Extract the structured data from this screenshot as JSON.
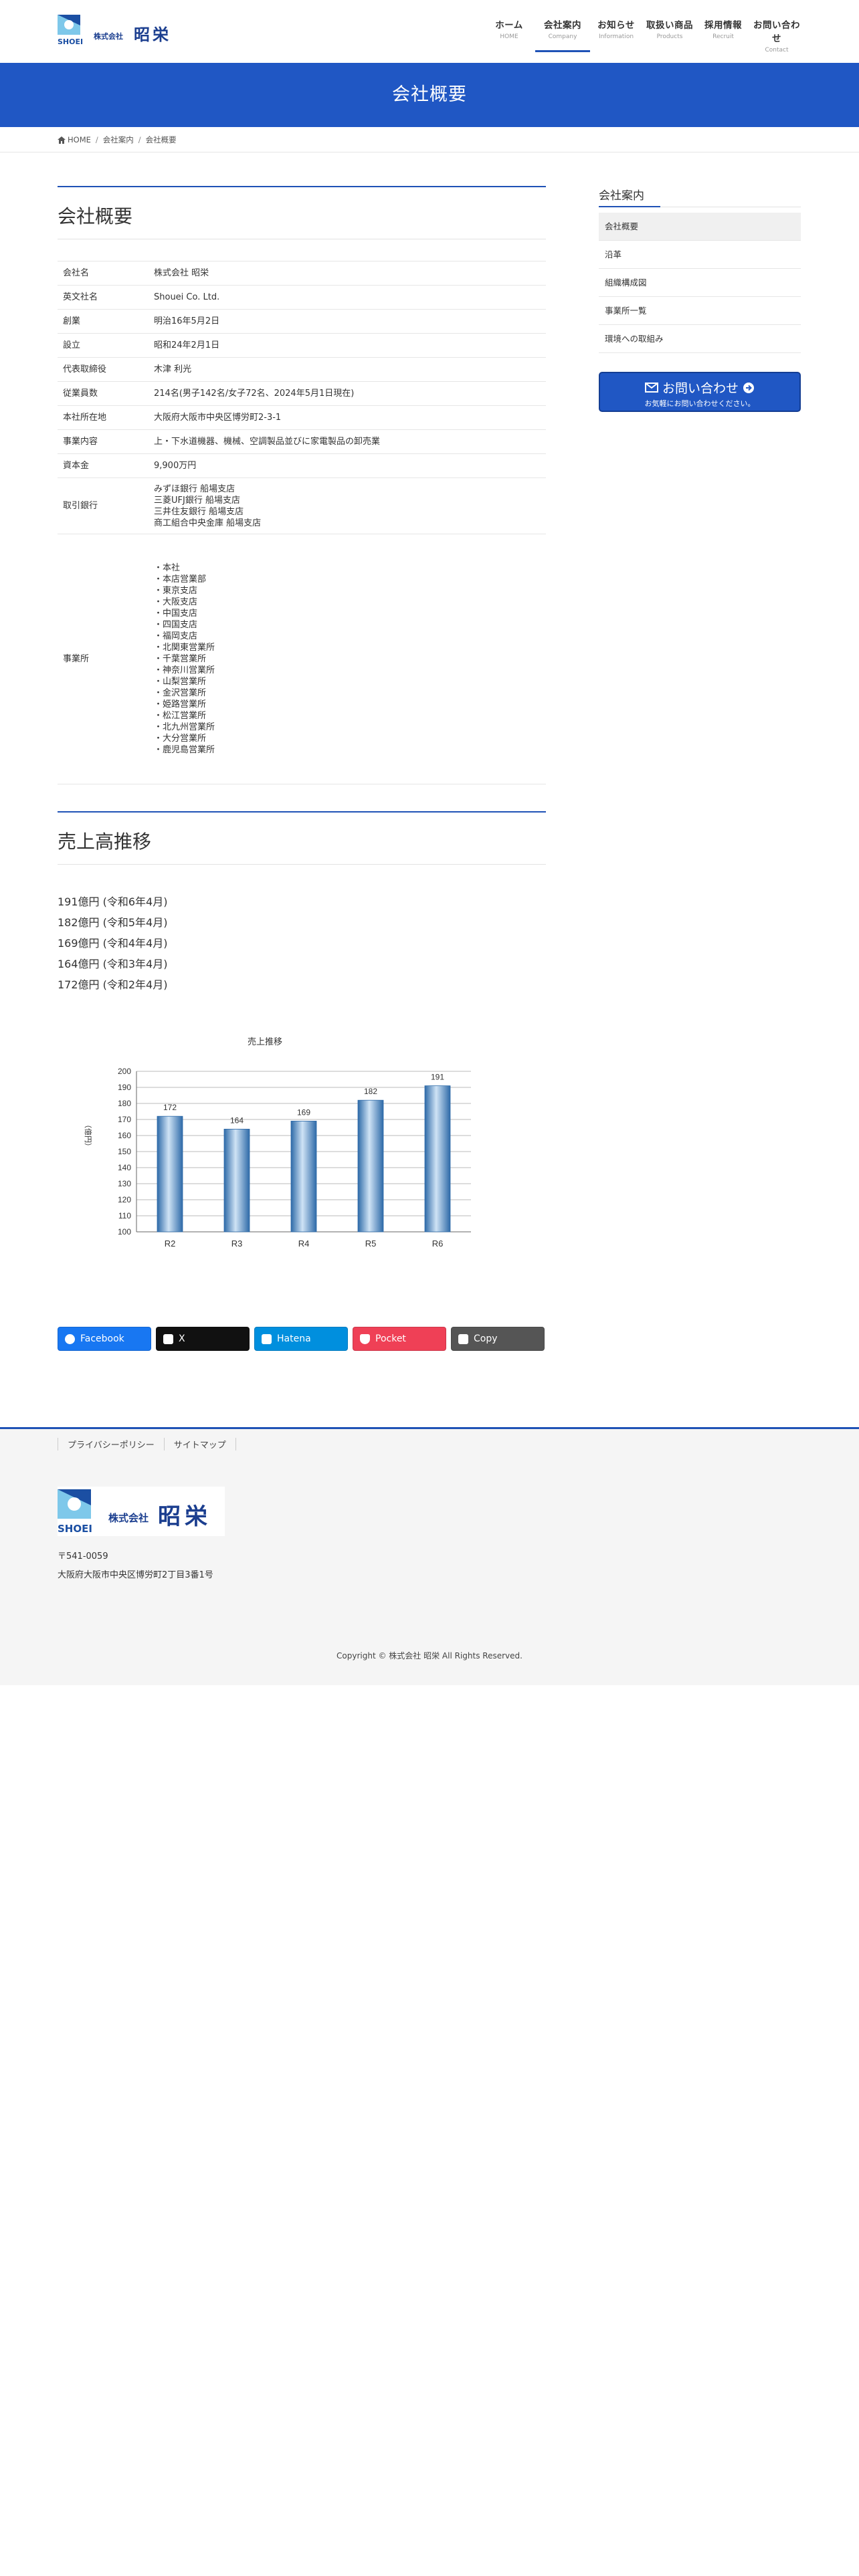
{
  "header": {
    "company_name_small": "株式会社",
    "company_name": "昭栄",
    "logo_text": "SHOEI",
    "nav": [
      {
        "label": "ホーム",
        "sub": "HOME"
      },
      {
        "label": "会社案内",
        "sub": "Company"
      },
      {
        "label": "お知らせ",
        "sub": "Information"
      },
      {
        "label": "取扱い商品",
        "sub": "Products"
      },
      {
        "label": "採用情報",
        "sub": "Recruit"
      },
      {
        "label": "お問い合わせ",
        "sub": "Contact"
      }
    ]
  },
  "page_title": "会社概要",
  "breadcrumb": {
    "home": "HOME",
    "parent": "会社案内",
    "current": "会社概要"
  },
  "overview": {
    "heading": "会社概要",
    "rows": [
      {
        "label": "会社名",
        "value": "株式会社 昭栄"
      },
      {
        "label": "英文社名",
        "value": "Shouei Co. Ltd."
      },
      {
        "label": "創業",
        "value": "明治16年5月2日"
      },
      {
        "label": "設立",
        "value": "昭和24年2月1日"
      },
      {
        "label": "代表取締役",
        "value": "木津 利光"
      },
      {
        "label": "従業員数",
        "value": "214名(男子142名/女子72名、2024年5月1日現在)"
      },
      {
        "label": "本社所在地",
        "value": "大阪府大阪市中央区博労町2-3-1"
      },
      {
        "label": "事業内容",
        "value": "上・下水道機器、機械、空調製品並びに家電製品の卸売業"
      },
      {
        "label": "資本金",
        "value": "9,900万円"
      }
    ],
    "bank_label": "取引銀行",
    "banks": [
      "みずほ銀行 船場支店",
      "三菱UFJ銀行 船場支店",
      "三井住友銀行 船場支店",
      "商工組合中央金庫 船場支店"
    ],
    "offices_label": "事業所",
    "offices": [
      "・本社",
      "・本店営業部",
      "・東京支店",
      "・大阪支店",
      "・中国支店",
      "・四国支店",
      "・福岡支店",
      "・北関東営業所",
      "・千葉営業所",
      "・神奈川営業所",
      "・山梨営業所",
      "・金沢営業所",
      "・姫路営業所",
      "・松江営業所",
      "・北九州営業所",
      "・大分営業所",
      "・鹿児島営業所"
    ]
  },
  "sales": {
    "heading": "売上高推移",
    "list": [
      "191億円 (令和6年4月)",
      "182億円 (令和5年4月)",
      "169億円 (令和4年4月)",
      "164億円 (令和3年4月)",
      "172億円 (令和2年4月)"
    ]
  },
  "chart_data": {
    "type": "bar",
    "title": "売上推移",
    "ylabel": "（億円）",
    "xlabel": "",
    "categories": [
      "R2",
      "R3",
      "R4",
      "R5",
      "R6"
    ],
    "values": [
      172,
      164,
      169,
      182,
      191
    ],
    "ylim": [
      100,
      200
    ],
    "yticks": [
      100,
      110,
      120,
      130,
      140,
      150,
      160,
      170,
      180,
      190,
      200
    ],
    "grid": true,
    "colors": {
      "bar": "#5b9bd5",
      "bar_dark": "#2e6aa8",
      "bar_light": "#cfe3f5"
    }
  },
  "share": [
    {
      "label": "Facebook",
      "icon": "facebook-icon",
      "color": "#1877f2"
    },
    {
      "label": "X",
      "icon": "x-icon",
      "color": "#111111"
    },
    {
      "label": "Hatena",
      "icon": "hatena-icon",
      "color": "#008fde"
    },
    {
      "label": "Pocket",
      "icon": "pocket-icon",
      "color": "#ef4056"
    },
    {
      "label": "Copy",
      "icon": "copy-icon",
      "color": "#555555"
    }
  ],
  "sidebar": {
    "title": "会社案内",
    "items": [
      "会社概要",
      "沿革",
      "組織構成図",
      "事業所一覧",
      "環境への取組み"
    ],
    "contact_label": "お問い合わせ",
    "contact_sub": "お気軽にお問い合わせください。"
  },
  "footer": {
    "links": [
      "プライバシーポリシー",
      "サイトマップ"
    ],
    "postal": "〒541-0059",
    "address": "大阪府大阪市中央区博労町2丁目3番1号",
    "copyright": "Copyright © 株式会社 昭栄 All Rights Reserved."
  },
  "colors": {
    "brand": "#2057c4",
    "accent": "#1f52b6"
  }
}
